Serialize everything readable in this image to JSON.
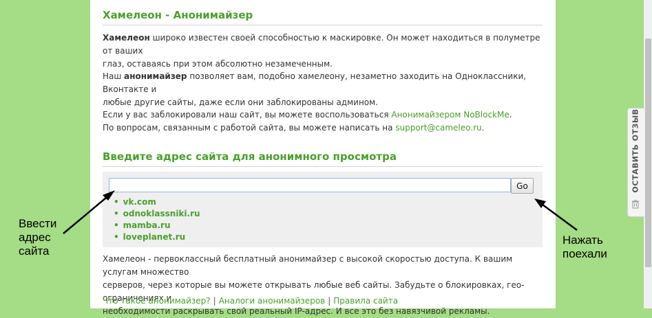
{
  "header": {
    "title": "Хамелеон - Анонимайзер"
  },
  "intro": {
    "p1_bold": "Хамелеон",
    "p1_line1": " широко известен своей способностью к маскировке. Он может находиться в полуметре от ваших",
    "p1_line2": "глаз, оставаясь при этом абсолютно незамеченным.",
    "p2_pre": "Наш ",
    "p2_bold": "анонимайзер",
    "p2_line1": " позволяет вам, подобно хамелеону, незаметно заходить на Одноклассники, Вконтакте и",
    "p2_line2": "любые другие сайты, даже если они заблокированы админом.",
    "p3_line1_pre": "Если у вас заблокировали наш сайт, вы можете воспользоваться ",
    "p3_link": "Анонимайзером NoBlockMe",
    "p3_line1_post": ".",
    "p3_line2_pre": "По вопросам, связанным с работой сайта, вы можете написать на ",
    "p3_email": "support@cameleo.ru",
    "p3_line2_post": "."
  },
  "form": {
    "heading": "Введите адрес сайта для анонимного просмотра",
    "url_value": "",
    "go_label": "Go",
    "quick_links": [
      "vk.com",
      "odnoklassniki.ru",
      "mamba.ru",
      "loveplanet.ru"
    ]
  },
  "about": {
    "line1": "Хамелеон - первоклассный бесплатный анонимайзер с высокой скоростью доступа. К вашим услугам множество",
    "line2": "серверов, через которые вы можете открывать любые веб сайты. Забудьте о блокировках, гео-ограничениях и",
    "line3": "необходимости раскрывать свой реальный IP-адрес. И все это без навязчивой рекламы."
  },
  "footer": {
    "links": [
      "Что такое анонимайзер?",
      "Аналоги анонимайзеров",
      "Правила сайта"
    ],
    "separator": "|"
  },
  "annotations": {
    "left": [
      "Ввести",
      "адрес",
      "сайта"
    ],
    "right": [
      "Нажать",
      "поехали"
    ]
  },
  "feedback_tab": {
    "label": "ОСТАВИТЬ ОТЗЫВ",
    "icon": "trash-can-icon"
  },
  "colors": {
    "background_green": "#a5dc86",
    "accent_green": "#4aa02c",
    "input_border": "#8fb6e6"
  }
}
